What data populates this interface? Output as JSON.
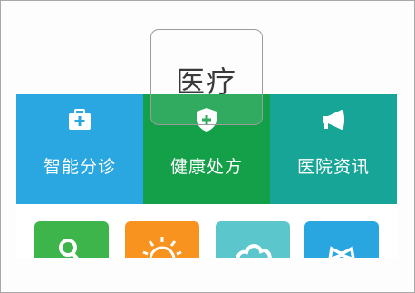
{
  "tooltip": {
    "text": "医疗"
  },
  "tiles": [
    {
      "label": "智能分诊",
      "icon": "medical-kit-icon",
      "color": "#2aa7e0"
    },
    {
      "label": "健康处方",
      "icon": "shield-cross-icon",
      "color": "#14a049"
    },
    {
      "label": "医院资讯",
      "icon": "megaphone-icon",
      "color": "#16a596"
    }
  ],
  "apps": [
    {
      "icon": "search-icon",
      "color": "#3db54a"
    },
    {
      "icon": "sun-icon",
      "color": "#f7931e"
    },
    {
      "icon": "cloud-icon",
      "color": "#5bc6cc"
    },
    {
      "icon": "bow-icon",
      "color": "#29a6e0"
    }
  ]
}
